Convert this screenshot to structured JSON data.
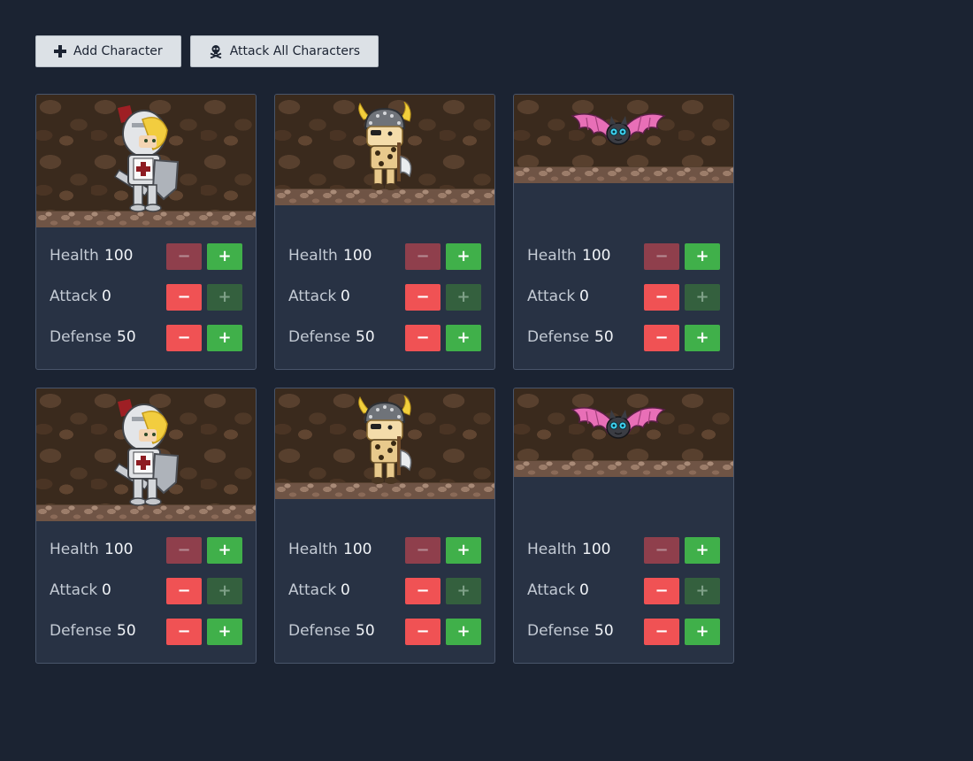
{
  "toolbar": {
    "add_label": "Add Character",
    "attack_label": "Attack All Characters"
  },
  "stat_labels": {
    "health": "Health",
    "attack": "Attack",
    "defense": "Defense"
  },
  "controls": {
    "minus": "−",
    "plus": "+"
  },
  "characters": [
    {
      "type": "knight",
      "health": "100",
      "attack": "0",
      "defense": "50"
    },
    {
      "type": "viking",
      "health": "100",
      "attack": "0",
      "defense": "50"
    },
    {
      "type": "bat",
      "health": "100",
      "attack": "0",
      "defense": "50"
    },
    {
      "type": "knight",
      "health": "100",
      "attack": "0",
      "defense": "50"
    },
    {
      "type": "viking",
      "health": "100",
      "attack": "0",
      "defense": "50"
    },
    {
      "type": "bat",
      "health": "100",
      "attack": "0",
      "defense": "50"
    }
  ],
  "colors": {
    "background": "#1b2332",
    "card": "#283244",
    "decrement": "#f05254",
    "increment": "#40b04a"
  }
}
